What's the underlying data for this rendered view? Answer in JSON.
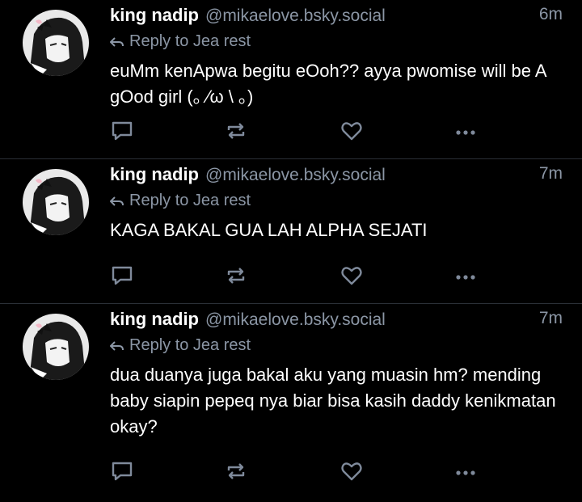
{
  "colors": {
    "background": "#000000",
    "text": "#ffffff",
    "muted": "#8b96a5",
    "divider": "#2a2f36",
    "icon": "#7f8a9b"
  },
  "icons": {
    "reply": "reply-arrow-icon",
    "comment": "comment-icon",
    "repost": "repost-icon",
    "like": "heart-icon",
    "more": "more-dots-icon"
  },
  "posts": [
    {
      "name": "king nadip",
      "handle": "@mikaelove.bsky.social",
      "time": "6m",
      "reply_to": "Reply to Jea rest",
      "text": "euMm kenApwa begitu eOoh?? ayya pwomise will be A gOod girl (｡ ⁄ω \\ ｡)"
    },
    {
      "name": "king nadip",
      "handle": "@mikaelove.bsky.social",
      "time": "7m",
      "reply_to": "Reply to Jea rest",
      "text": "KAGA BAKAL GUA LAH ALPHA SEJATI"
    },
    {
      "name": "king nadip",
      "handle": "@mikaelove.bsky.social",
      "time": "7m",
      "reply_to": "Reply to Jea rest",
      "text": "dua duanya juga bakal aku yang muasin hm? mending baby siapin pepeq nya biar bisa kasih daddy kenikmatan okay?"
    }
  ]
}
